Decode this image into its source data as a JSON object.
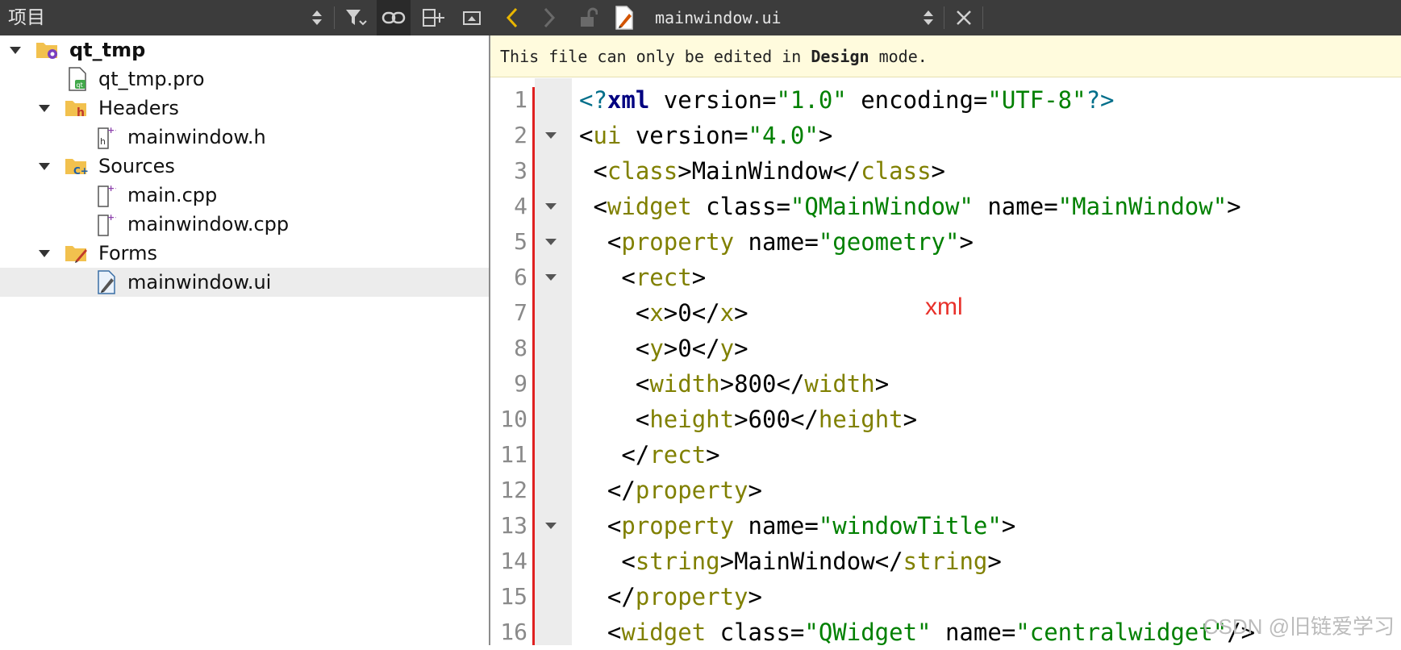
{
  "left_panel": {
    "title": "项目",
    "tree": [
      {
        "label": "qt_tmp",
        "icon": "project-folder-icon",
        "bold": true,
        "expanded": true
      },
      {
        "label": "qt_tmp.pro",
        "icon": "qt-project-file-icon"
      },
      {
        "label": "Headers",
        "icon": "headers-folder-icon",
        "expanded": true
      },
      {
        "label": "mainwindow.h",
        "icon": "header-file-icon"
      },
      {
        "label": "Sources",
        "icon": "sources-folder-icon",
        "expanded": true
      },
      {
        "label": "main.cpp",
        "icon": "cpp-file-icon"
      },
      {
        "label": "mainwindow.cpp",
        "icon": "cpp-file-icon"
      },
      {
        "label": "Forms",
        "icon": "forms-folder-icon",
        "expanded": true
      },
      {
        "label": "mainwindow.ui",
        "icon": "ui-file-icon",
        "selected": true
      }
    ]
  },
  "editor": {
    "file_name": "mainwindow.ui",
    "info_message": {
      "prefix": "This file can only be edited in ",
      "emphasis": "Design",
      "suffix": " mode."
    },
    "lines": [
      {
        "number": "1",
        "fold": false,
        "tokens": [
          [
            "decl",
            "<?"
          ],
          [
            "decl-b",
            "xml"
          ],
          [
            "attr",
            " version="
          ],
          [
            "val",
            "\"1.0\""
          ],
          [
            "attr",
            " encoding="
          ],
          [
            "val",
            "\"UTF-8\""
          ],
          [
            "decl",
            "?>"
          ]
        ]
      },
      {
        "number": "2",
        "fold": true,
        "tokens": [
          [
            "br",
            "<"
          ],
          [
            "tag",
            "ui"
          ],
          [
            "attr",
            " version="
          ],
          [
            "val",
            "\"4.0\""
          ],
          [
            "br",
            ">"
          ]
        ]
      },
      {
        "number": "3",
        "fold": false,
        "tokens": [
          [
            "br",
            " <"
          ],
          [
            "tag",
            "class"
          ],
          [
            "br",
            ">"
          ],
          [
            "text",
            "MainWindow"
          ],
          [
            "br",
            "</"
          ],
          [
            "tag",
            "class"
          ],
          [
            "br",
            ">"
          ]
        ]
      },
      {
        "number": "4",
        "fold": true,
        "tokens": [
          [
            "br",
            " <"
          ],
          [
            "tag",
            "widget"
          ],
          [
            "attr",
            " class="
          ],
          [
            "val",
            "\"QMainWindow\""
          ],
          [
            "attr",
            " name="
          ],
          [
            "val",
            "\"MainWindow\""
          ],
          [
            "br",
            ">"
          ]
        ]
      },
      {
        "number": "5",
        "fold": true,
        "tokens": [
          [
            "br",
            "  <"
          ],
          [
            "tag",
            "property"
          ],
          [
            "attr",
            " name="
          ],
          [
            "val",
            "\"geometry\""
          ],
          [
            "br",
            ">"
          ]
        ]
      },
      {
        "number": "6",
        "fold": true,
        "tokens": [
          [
            "br",
            "   <"
          ],
          [
            "tag",
            "rect"
          ],
          [
            "br",
            ">"
          ]
        ]
      },
      {
        "number": "7",
        "fold": false,
        "tokens": [
          [
            "br",
            "    <"
          ],
          [
            "tag",
            "x"
          ],
          [
            "br",
            ">"
          ],
          [
            "text",
            "0"
          ],
          [
            "br",
            "</"
          ],
          [
            "tag",
            "x"
          ],
          [
            "br",
            ">"
          ]
        ]
      },
      {
        "number": "8",
        "fold": false,
        "tokens": [
          [
            "br",
            "    <"
          ],
          [
            "tag",
            "y"
          ],
          [
            "br",
            ">"
          ],
          [
            "text",
            "0"
          ],
          [
            "br",
            "</"
          ],
          [
            "tag",
            "y"
          ],
          [
            "br",
            ">"
          ]
        ]
      },
      {
        "number": "9",
        "fold": false,
        "tokens": [
          [
            "br",
            "    <"
          ],
          [
            "tag",
            "width"
          ],
          [
            "br",
            ">"
          ],
          [
            "text",
            "800"
          ],
          [
            "br",
            "</"
          ],
          [
            "tag",
            "width"
          ],
          [
            "br",
            ">"
          ]
        ]
      },
      {
        "number": "10",
        "fold": false,
        "tokens": [
          [
            "br",
            "    <"
          ],
          [
            "tag",
            "height"
          ],
          [
            "br",
            ">"
          ],
          [
            "text",
            "600"
          ],
          [
            "br",
            "</"
          ],
          [
            "tag",
            "height"
          ],
          [
            "br",
            ">"
          ]
        ]
      },
      {
        "number": "11",
        "fold": false,
        "tokens": [
          [
            "br",
            "   </"
          ],
          [
            "tag",
            "rect"
          ],
          [
            "br",
            ">"
          ]
        ]
      },
      {
        "number": "12",
        "fold": false,
        "tokens": [
          [
            "br",
            "  </"
          ],
          [
            "tag",
            "property"
          ],
          [
            "br",
            ">"
          ]
        ]
      },
      {
        "number": "13",
        "fold": true,
        "tokens": [
          [
            "br",
            "  <"
          ],
          [
            "tag",
            "property"
          ],
          [
            "attr",
            " name="
          ],
          [
            "val",
            "\"windowTitle\""
          ],
          [
            "br",
            ">"
          ]
        ]
      },
      {
        "number": "14",
        "fold": false,
        "tokens": [
          [
            "br",
            "   <"
          ],
          [
            "tag",
            "string"
          ],
          [
            "br",
            ">"
          ],
          [
            "text",
            "MainWindow"
          ],
          [
            "br",
            "</"
          ],
          [
            "tag",
            "string"
          ],
          [
            "br",
            ">"
          ]
        ]
      },
      {
        "number": "15",
        "fold": false,
        "tokens": [
          [
            "br",
            "  </"
          ],
          [
            "tag",
            "property"
          ],
          [
            "br",
            ">"
          ]
        ]
      },
      {
        "number": "16",
        "fold": false,
        "tokens": [
          [
            "br",
            "  <"
          ],
          [
            "tag",
            "widget"
          ],
          [
            "attr",
            " class="
          ],
          [
            "val",
            "\"QWidget\""
          ],
          [
            "attr",
            " name="
          ],
          [
            "val",
            "\"centralwidget\""
          ],
          [
            "br",
            "/>"
          ]
        ]
      }
    ]
  },
  "annotation": "xml",
  "watermark": "CSDN @旧链爱学习"
}
